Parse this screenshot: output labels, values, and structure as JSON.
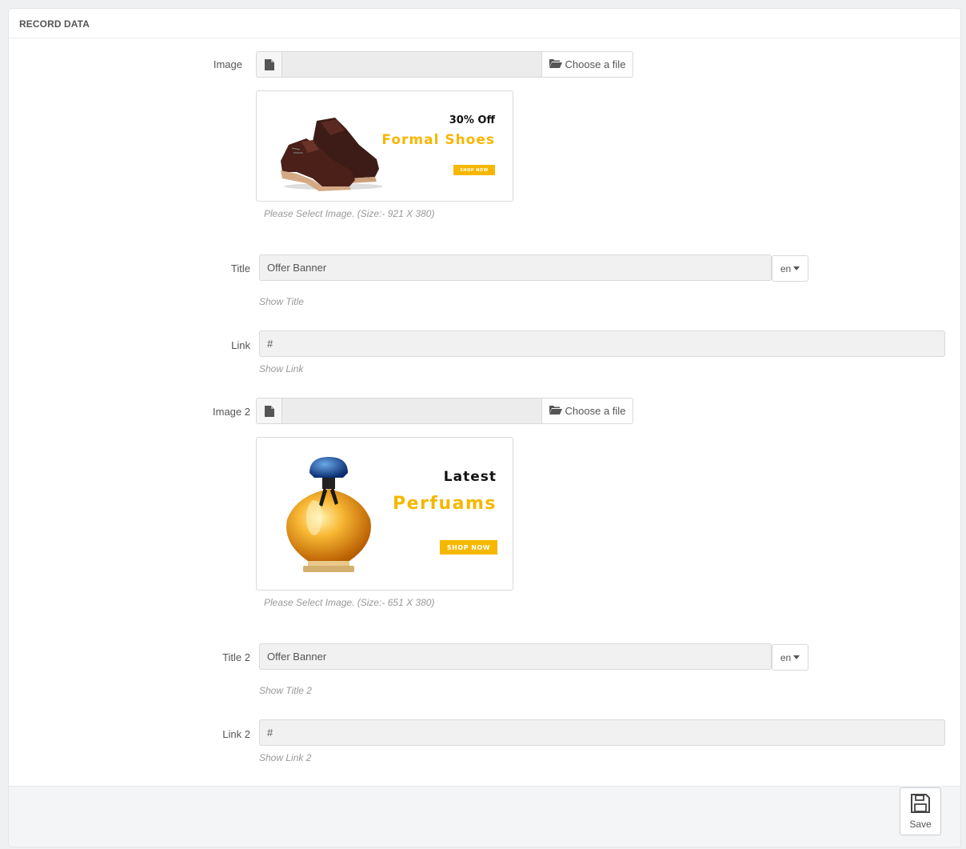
{
  "panel": {
    "heading": "RECORD DATA"
  },
  "colors": {
    "accent": "#f5b700",
    "input_bg": "#f1f1f1",
    "border": "#d6d9dc",
    "hint": "#999999"
  },
  "fields": {
    "image": {
      "label": "Image",
      "button_label": "Choose a file",
      "hint": "Please Select Image. (Size:- 921 X 380)",
      "preview": {
        "line1": "30% Off",
        "line2": "Formal Shoes",
        "cta": "SHOP NOW",
        "subject": "shoes-illustration"
      }
    },
    "title": {
      "label": "Title",
      "value": "Offer Banner",
      "lang": "en",
      "hint": "Show Title"
    },
    "link": {
      "label": "Link",
      "value": "#",
      "hint": "Show Link"
    },
    "image2": {
      "label": "Image 2",
      "button_label": "Choose a file",
      "hint": "Please Select Image. (Size:- 651 X 380)",
      "preview": {
        "line1": "Latest",
        "line2": "Perfuams",
        "cta": "SHOP NOW",
        "subject": "perfume-bottle-illustration"
      }
    },
    "title2": {
      "label": "Title 2",
      "value": "Offer Banner",
      "lang": "en",
      "hint": "Show Title 2"
    },
    "link2": {
      "label": "Link 2",
      "value": "#",
      "hint": "Show Link 2"
    }
  },
  "footer": {
    "save_label": "Save",
    "save_icon": "floppy-disk-icon"
  }
}
